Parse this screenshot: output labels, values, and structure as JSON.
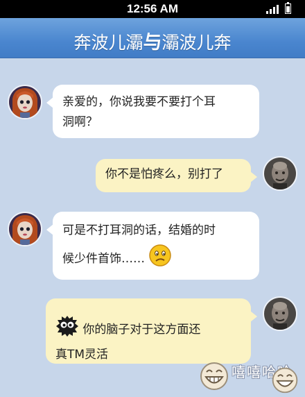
{
  "status_bar": {
    "time": "12:56 AM"
  },
  "header": {
    "title_left": "奔波儿灞",
    "title_sep": "与",
    "title_right": "灞波儿奔"
  },
  "messages": [
    {
      "sender": "奔波儿灞",
      "side": "left",
      "bubble_color": "#ffffff",
      "line1": "亲爱的，你说我要不要打个耳",
      "line2": "洞啊？"
    },
    {
      "sender": "灞波儿奔",
      "side": "right",
      "bubble_color": "#fbf3c4",
      "line1": "你不是怕疼么，别打了"
    },
    {
      "sender": "奔波儿灞",
      "side": "left",
      "bubble_color": "#ffffff",
      "line1": "可是不打耳洞的话，结婚的时",
      "line2": "候少件首饰……",
      "emoji": "confused-face-emoji"
    },
    {
      "sender": "灞波儿奔",
      "side": "right",
      "bubble_color": "#fbf3c4",
      "emoji": "black-soot-emoji",
      "line1": "你的脑子对于这方面还",
      "line2": "真TM灵活"
    }
  ],
  "watermark": {
    "text": "嘻嘻哈哈",
    "icon": "laughing-face-logo"
  },
  "colors": {
    "background": "#c7d6ea",
    "header": "#4a86cf",
    "bubble_left": "#ffffff",
    "bubble_right": "#fbf3c4"
  }
}
